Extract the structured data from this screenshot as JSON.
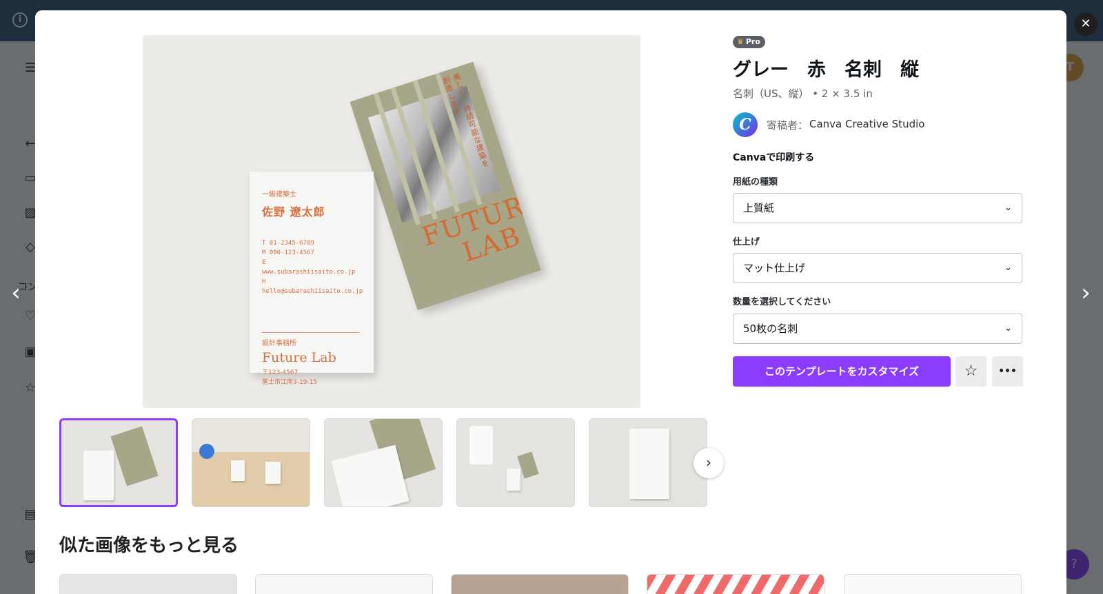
{
  "background": {
    "sidebar_text": "コン",
    "help_label": "?",
    "avatar_initial": "T"
  },
  "modal": {
    "close_label": "✕",
    "prev_label": "‹",
    "next_label": "›"
  },
  "preview": {
    "front_card": {
      "title": "一級建築士",
      "name": "佐野 遼太郎",
      "contacts": [
        "T 01-2345-6789",
        "M 090-123-4567",
        "E www.subarashiisaito.co.jp",
        "H hello@subarashiisaito.co.jp"
      ],
      "office": "設計事務所",
      "logo": "Future Lab",
      "postal": "〒123-4567",
      "address": "富士市江南3-19-15"
    },
    "back_card": {
      "vertical_text_1": "美しく、持続可能な建築を",
      "vertical_text_2": "創造します",
      "logo_line1": "FUTURE",
      "logo_line2": "LAB"
    }
  },
  "thumbnails": {
    "count": 5,
    "selected_index": 0,
    "next_label": "›"
  },
  "similar": {
    "title": "似た画像をもっと見る"
  },
  "panel": {
    "pro_label": "Pro",
    "title": "グレー　赤　名刺　縦",
    "subtitle": "名刺（US、縦） • 2 × 3.5 in",
    "contributor_prefix": "寄稿者：",
    "contributor_name": "Canva Creative Studio",
    "contributor_logo": "C",
    "print_heading": "Canvaで印刷する",
    "paper_label": "用紙の種類",
    "paper_value": "上質紙",
    "finish_label": "仕上げ",
    "finish_value": "マット仕上げ",
    "quantity_label": "数量を選択してください",
    "quantity_value": "50枚の名刺",
    "customize_label": "このテンプレートをカスタマイズ",
    "favorite_icon": "☆",
    "more_icon": "•••"
  },
  "colors": {
    "accent": "#8b3dff",
    "card_orange": "#d56f3e",
    "card_sage": "#a7a689"
  }
}
